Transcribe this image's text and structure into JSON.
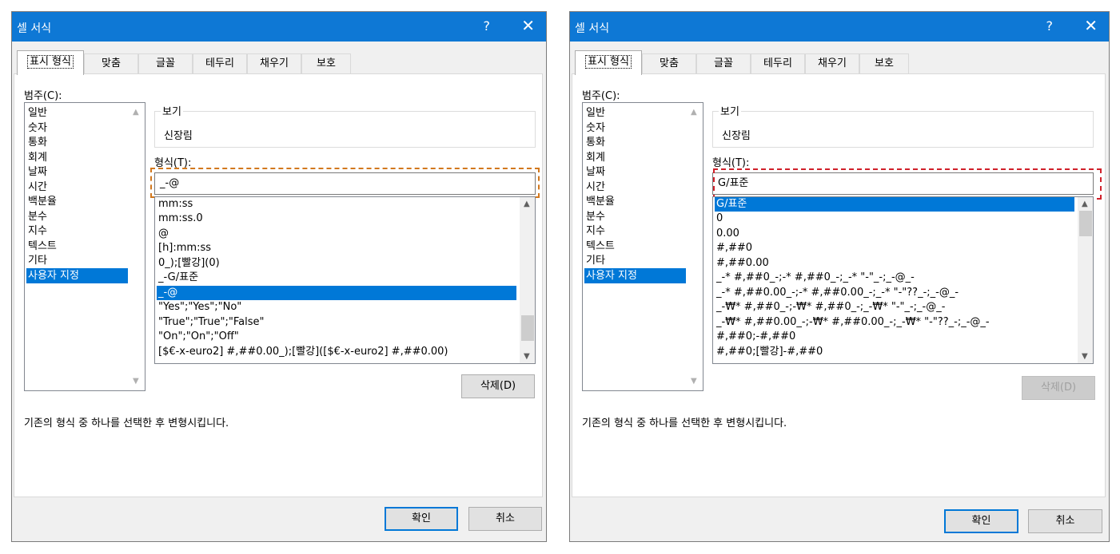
{
  "dialogs": [
    {
      "title": "셀 서식",
      "help": "?",
      "close": "✕",
      "tabs": [
        "표시 형식",
        "맞춤",
        "글꼴",
        "테두리",
        "채우기",
        "보호"
      ],
      "category_label": "범주(C):",
      "categories": [
        "일반",
        "숫자",
        "통화",
        "회계",
        "날짜",
        "시간",
        "백분율",
        "분수",
        "지수",
        "텍스트",
        "기타",
        "사용자 지정"
      ],
      "selected_category": "사용자 지정",
      "preview_label": "보기",
      "preview_value": "신장림",
      "format_label": "형식(T):",
      "format_value": "_-@",
      "format_codes": [
        "mm:ss",
        "mm:ss.0",
        "@",
        "[h]:mm:ss",
        "0_);[빨강](0)",
        "_-G/표준",
        "_-@",
        "\"Yes\";\"Yes\";\"No\"",
        "\"True\";\"True\";\"False\"",
        "\"On\";\"On\";\"Off\"",
        "[$€-x-euro2] #,##0.00_);[빨강]([$€-x-euro2] #,##0.00)"
      ],
      "selected_code": "_-@",
      "scroll_up": "▲",
      "scroll_down": "▼",
      "delete_button": "삭제(D)",
      "delete_enabled": true,
      "description": "기존의 형식 중 하나를 선택한 후 변형시킵니다.",
      "ok_button": "확인",
      "cancel_button": "취소"
    },
    {
      "title": "셀 서식",
      "help": "?",
      "close": "✕",
      "tabs": [
        "표시 형식",
        "맞춤",
        "글꼴",
        "테두리",
        "채우기",
        "보호"
      ],
      "category_label": "범주(C):",
      "categories": [
        "일반",
        "숫자",
        "통화",
        "회계",
        "날짜",
        "시간",
        "백분율",
        "분수",
        "지수",
        "텍스트",
        "기타",
        "사용자 지정"
      ],
      "selected_category": "사용자 지정",
      "preview_label": "보기",
      "preview_value": "신장림",
      "format_label": "형식(T):",
      "format_value": "G/표준",
      "format_codes": [
        "G/표준",
        "0",
        "0.00",
        "#,##0",
        "#,##0.00",
        "_-* #,##0_-;-* #,##0_-;_-* \"-\"_-;_-@_-",
        "_-* #,##0.00_-;-* #,##0.00_-;_-* \"-\"??_-;_-@_-",
        "_-₩* #,##0_-;-₩* #,##0_-;_-₩* \"-\"_-;_-@_-",
        "_-₩* #,##0.00_-;-₩* #,##0.00_-;_-₩* \"-\"??_-;_-@_-",
        "#,##0;-#,##0",
        "#,##0;[빨강]-#,##0"
      ],
      "selected_code": "G/표준",
      "scroll_up": "▲",
      "scroll_down": "▼",
      "delete_button": "삭제(D)",
      "delete_enabled": false,
      "description": "기존의 형식 중 하나를 선택한 후 변형시킵니다.",
      "ok_button": "확인",
      "cancel_button": "취소"
    }
  ],
  "colors": {
    "titlebar": "#0e78d5",
    "selection": "#0078d7",
    "highlight_left": "#d2781e",
    "highlight_right": "#d0202a"
  }
}
